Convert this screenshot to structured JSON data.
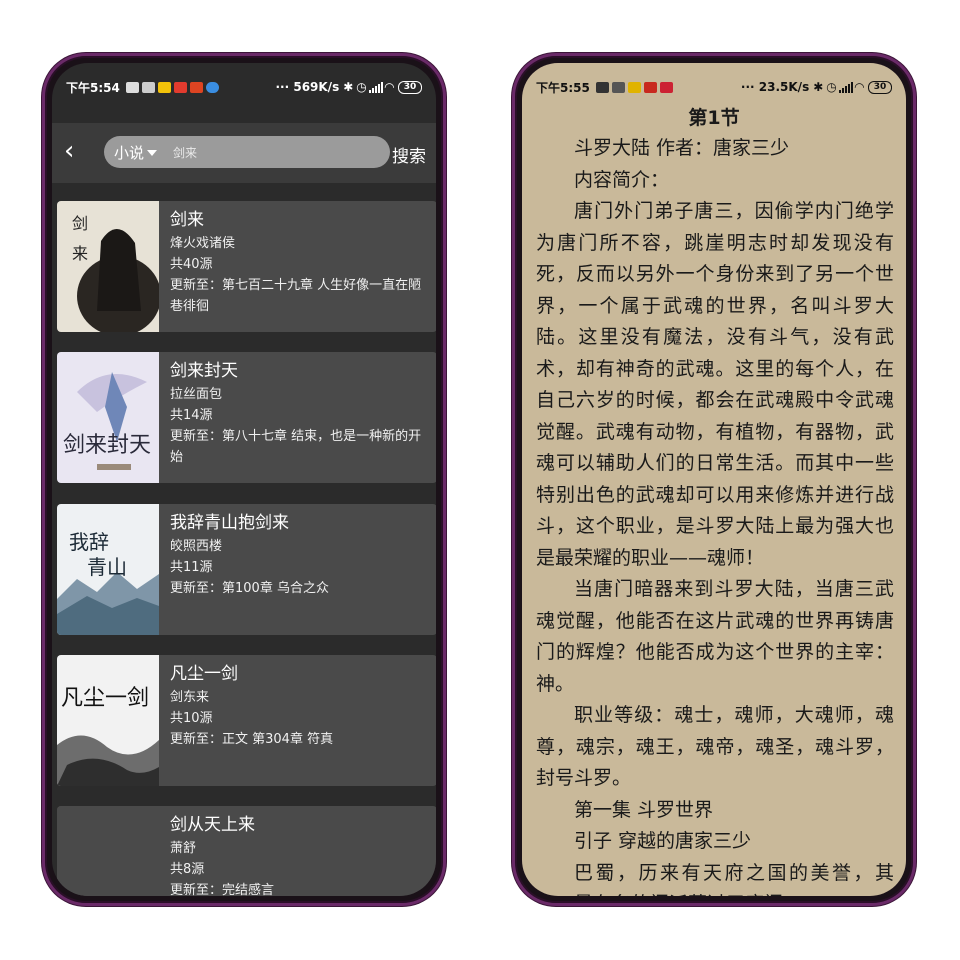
{
  "left_phone": {
    "status": {
      "time": "下午5:54",
      "speed": "··· 569K/s",
      "battery": "30"
    },
    "header": {
      "category": "小说",
      "query": "剑来",
      "search_label": "搜索"
    },
    "books": [
      {
        "title": "剑来",
        "author": "烽火戏诸侯",
        "sources": "共40源",
        "update": "更新至：第七百二十九章 人生好像一直在陋巷徘徊"
      },
      {
        "title": "剑来封天",
        "author": "拉丝面包",
        "sources": "共14源",
        "update": "更新至：第八十七章 结束，也是一种新的开始"
      },
      {
        "title": "我辞青山抱剑来",
        "author": "皎照西楼",
        "sources": "共11源",
        "update": "更新至：第100章 乌合之众"
      },
      {
        "title": "凡尘一剑",
        "author": "剑东来",
        "sources": "共10源",
        "update": "更新至：正文 第304章 符真"
      },
      {
        "title": "剑从天上来",
        "author": "萧舒",
        "sources": "共8源",
        "update": "更新至：完结感言"
      }
    ]
  },
  "right_phone": {
    "status": {
      "time": "下午5:55",
      "speed": "··· 23.5K/s",
      "battery": "30"
    },
    "chapter_title": "第1节",
    "paragraphs": [
      "斗罗大陆 作者：唐家三少",
      "内容简介：",
      "唐门外门弟子唐三，因偷学内门绝学为唐门所不容，跳崖明志时却发现没有死，反而以另外一个身份来到了另一个世界，一个属于武魂的世界，名叫斗罗大陆。这里没有魔法，没有斗气，没有武术，却有神奇的武魂。这里的每个人，在自己六岁的时候，都会在武魂殿中令武魂觉醒。武魂有动物，有植物，有器物，武魂可以辅助人们的日常生活。而其中一些特别出色的武魂却可以用来修炼并进行战斗，这个职业，是斗罗大陆上最为强大也是最荣耀的职业——魂师！",
      "当唐门暗器来到斗罗大陆，当唐三武魂觉醒，他能否在这片武魂的世界再铸唐门的辉煌？他能否成为这个世界的主宰：神。",
      "职业等级：魂士，魂师，大魂师，魂尊，魂宗，魂王，魂帝，魂圣，魂斗罗，封号斗罗。",
      "第一集 斗罗世界",
      "引子 穿越的唐家三少",
      "巴蜀，历来有天府之国的美誉，其中，最有名的门派莫过于唐门。"
    ]
  }
}
